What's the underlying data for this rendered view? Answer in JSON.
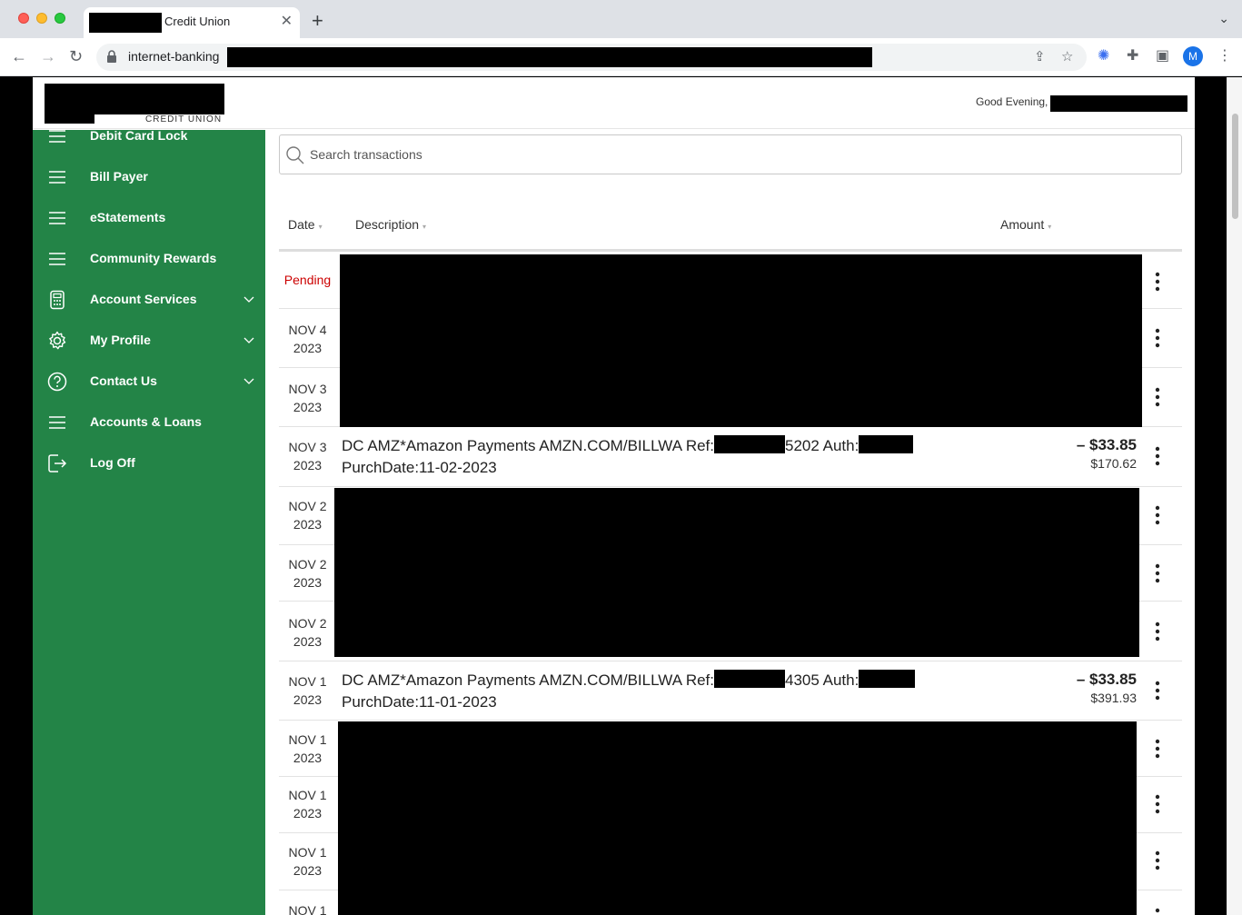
{
  "browser": {
    "tab_title": "Credit Union",
    "url": "internet-banking",
    "profile_initial": "M"
  },
  "header": {
    "logo_sub": "CREDIT UNION",
    "greeting": "Good Evening,"
  },
  "sidebar": {
    "items": [
      {
        "label": "Debit Card Lock",
        "icon": "menu-icon"
      },
      {
        "label": "Bill Payer",
        "icon": "menu-icon"
      },
      {
        "label": "eStatements",
        "icon": "menu-icon"
      },
      {
        "label": "Community Rewards",
        "icon": "menu-icon"
      },
      {
        "label": "Account Services",
        "icon": "calculator-icon"
      },
      {
        "label": "My Profile",
        "icon": "gear-icon"
      },
      {
        "label": "Contact Us",
        "icon": "help-icon"
      },
      {
        "label": "Accounts & Loans",
        "icon": "menu-icon"
      },
      {
        "label": "Log Off",
        "icon": "logout-icon"
      }
    ]
  },
  "search": {
    "placeholder": "Search transactions"
  },
  "table": {
    "headers": {
      "date": "Date",
      "description": "Description",
      "amount": "Amount"
    },
    "rows": [
      {
        "date1": "Pending",
        "date2": ""
      },
      {
        "date1": "NOV 4",
        "date2": "2023"
      },
      {
        "date1": "NOV 3",
        "date2": "2023"
      },
      {
        "date1": "NOV 3",
        "date2": "2023",
        "desc1_a": "DC AMZ*Amazon Payments AMZN.COM/BILLWA Ref:",
        "desc1_b": "5202 Auth:",
        "desc2": "PurchDate:11-02-2023",
        "amount": "– $33.85",
        "balance": "$170.62"
      },
      {
        "date1": "NOV 2",
        "date2": "2023"
      },
      {
        "date1": "NOV 2",
        "date2": "2023"
      },
      {
        "date1": "NOV 2",
        "date2": "2023"
      },
      {
        "date1": "NOV 1",
        "date2": "2023",
        "desc1_a": "DC AMZ*Amazon Payments AMZN.COM/BILLWA Ref:",
        "desc1_b": "4305 Auth:",
        "desc2": "PurchDate:11-01-2023",
        "amount": "– $33.85",
        "balance": "$391.93"
      },
      {
        "date1": "NOV 1",
        "date2": "2023"
      },
      {
        "date1": "NOV 1",
        "date2": "2023"
      },
      {
        "date1": "NOV 1",
        "date2": "2023"
      },
      {
        "date1": "NOV 1",
        "date2": ""
      }
    ]
  }
}
